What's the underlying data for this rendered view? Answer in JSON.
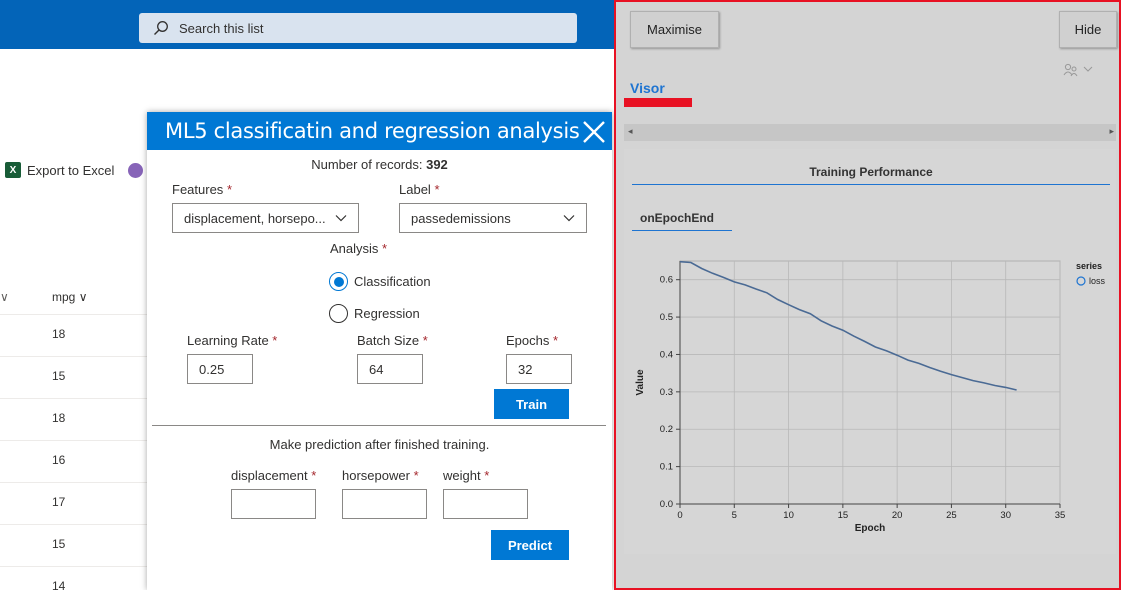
{
  "search": {
    "placeholder": "Search this list"
  },
  "cmdbar": {
    "export_label": "Export to Excel"
  },
  "list": {
    "column_header": "mpg",
    "rows": [
      "18",
      "15",
      "18",
      "16",
      "17",
      "15",
      "14"
    ]
  },
  "dialog": {
    "title": "ML5 classificatin and regression analysis",
    "records_label": "Number of records:",
    "records_count": "392",
    "features_label": "Features",
    "features_value": "displacement, horsepo...",
    "label_label": "Label",
    "label_value": "passedemissions",
    "analysis_label": "Analysis",
    "analysis_options": [
      "Classification",
      "Regression"
    ],
    "analysis_selected": "Classification",
    "learning_rate_label": "Learning Rate",
    "learning_rate_value": "0.25",
    "batch_size_label": "Batch Size",
    "batch_size_value": "64",
    "epochs_label": "Epochs",
    "epochs_value": "32",
    "train_button": "Train",
    "prediction_note": "Make prediction after finished training.",
    "pred_fields": [
      "displacement",
      "horsepower",
      "weight"
    ],
    "predict_button": "Predict",
    "required_mark": "*"
  },
  "visor": {
    "maximise_button": "Maximise",
    "hide_button": "Hide",
    "title": "Visor",
    "surface_title": "Training Performance",
    "tab_label": "onEpochEnd"
  },
  "colors": {
    "brand_blue": "#0078d4",
    "topbar_blue": "#0364b8",
    "highlight_red": "#e81123",
    "line_series": "#4a6a94"
  },
  "chart_data": {
    "type": "line",
    "xlabel": "Epoch",
    "ylabel": "Value",
    "xlim": [
      0,
      35
    ],
    "ylim": [
      0,
      0.65
    ],
    "xticks": [
      0,
      5,
      10,
      15,
      20,
      25,
      30,
      35
    ],
    "yticks": [
      0.0,
      0.1,
      0.2,
      0.3,
      0.4,
      0.5,
      0.6
    ],
    "grid": true,
    "legend_title": "series",
    "legend_position": "right",
    "series": [
      {
        "name": "loss",
        "x": [
          0,
          1,
          2,
          3,
          4,
          5,
          6,
          7,
          8,
          9,
          10,
          11,
          12,
          13,
          14,
          15,
          16,
          17,
          18,
          19,
          20,
          21,
          22,
          23,
          24,
          25,
          26,
          27,
          28,
          29,
          30,
          31
        ],
        "values": [
          0.648,
          0.646,
          0.63,
          0.617,
          0.606,
          0.594,
          0.586,
          0.575,
          0.565,
          0.547,
          0.533,
          0.52,
          0.509,
          0.49,
          0.476,
          0.465,
          0.449,
          0.435,
          0.42,
          0.41,
          0.398,
          0.385,
          0.376,
          0.365,
          0.355,
          0.346,
          0.338,
          0.33,
          0.324,
          0.317,
          0.312,
          0.305
        ]
      }
    ]
  }
}
